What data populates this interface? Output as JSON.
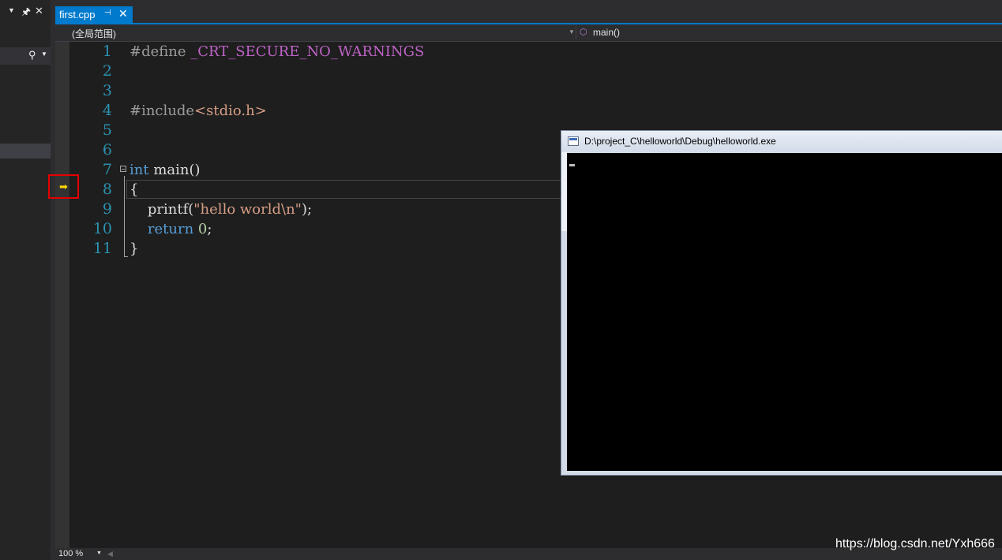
{
  "left_panel": {
    "header_icons": [
      "chevron-down-icon",
      "pin-icon",
      "close-icon"
    ],
    "search_icon": "search-icon"
  },
  "tab": {
    "title": "first.cpp",
    "pin_glyph": "⊣",
    "close_glyph": "✕"
  },
  "navbar": {
    "scope": "(全局范围)",
    "function": "main()"
  },
  "editor": {
    "line_numbers": [
      "1",
      "2",
      "3",
      "4",
      "5",
      "6",
      "7",
      "8",
      "9",
      "10",
      "11"
    ],
    "lines": {
      "l1_pp": "#define ",
      "l1_macro": "_CRT_SECURE_NO_WARNINGS",
      "l4_pp": "#include",
      "l4_inc": "<stdio.h>",
      "l7_kw": "int",
      "l7_rest": " main()",
      "l8": "{",
      "l9_fn": "    printf(",
      "l9_str": "\"hello world\\n\"",
      "l9_end": ");",
      "l10_kw": "    return ",
      "l10_num": "0",
      "l10_end": ";",
      "l11": "}"
    },
    "current_line": 8,
    "debug_arrow": "➡"
  },
  "bottombar": {
    "zoom": "100 %"
  },
  "console": {
    "title": "D:\\project_C\\helloworld\\Debug\\helloworld.exe"
  },
  "watermark": "https://blog.csdn.net/Yxh666",
  "colors": {
    "accent": "#007acc",
    "editor_bg": "#1e1e1e",
    "line_number": "#2b91af",
    "keyword": "#569cd6",
    "string": "#d69d85",
    "macro": "#bd63c5",
    "debug_box": "#e60000"
  }
}
